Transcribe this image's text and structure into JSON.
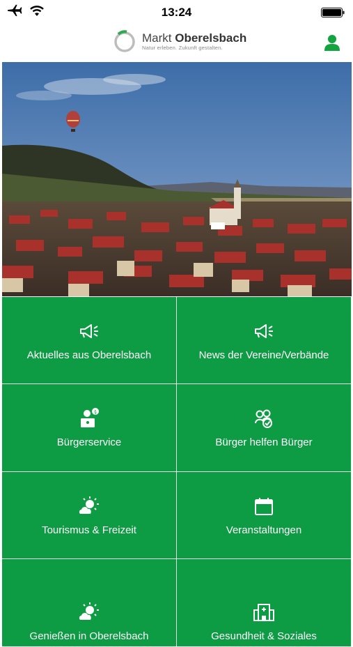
{
  "status": {
    "time": "13:24"
  },
  "header": {
    "brand_light": "Markt ",
    "brand_bold": "Oberelsbach",
    "tagline": "Natur erleben. Zukunft gestalten."
  },
  "tiles": [
    {
      "label": "Aktuelles aus Oberelsbach",
      "icon": "megaphone-icon"
    },
    {
      "label": "News der Vereine/Verbände",
      "icon": "megaphone-icon"
    },
    {
      "label": "Bürgerservice",
      "icon": "citizen-service-icon"
    },
    {
      "label": "Bürger helfen Bürger",
      "icon": "people-help-icon"
    },
    {
      "label": "Tourismus & Freizeit",
      "icon": "sun-cloud-icon"
    },
    {
      "label": "Veranstaltungen",
      "icon": "calendar-icon"
    },
    {
      "label": "Genießen in Oberelsbach",
      "icon": "sun-cloud-icon"
    },
    {
      "label": "Gesundheit & Soziales",
      "icon": "hospital-icon"
    }
  ],
  "colors": {
    "tile_green": "#0d9b43",
    "user_icon": "#13a33f"
  }
}
